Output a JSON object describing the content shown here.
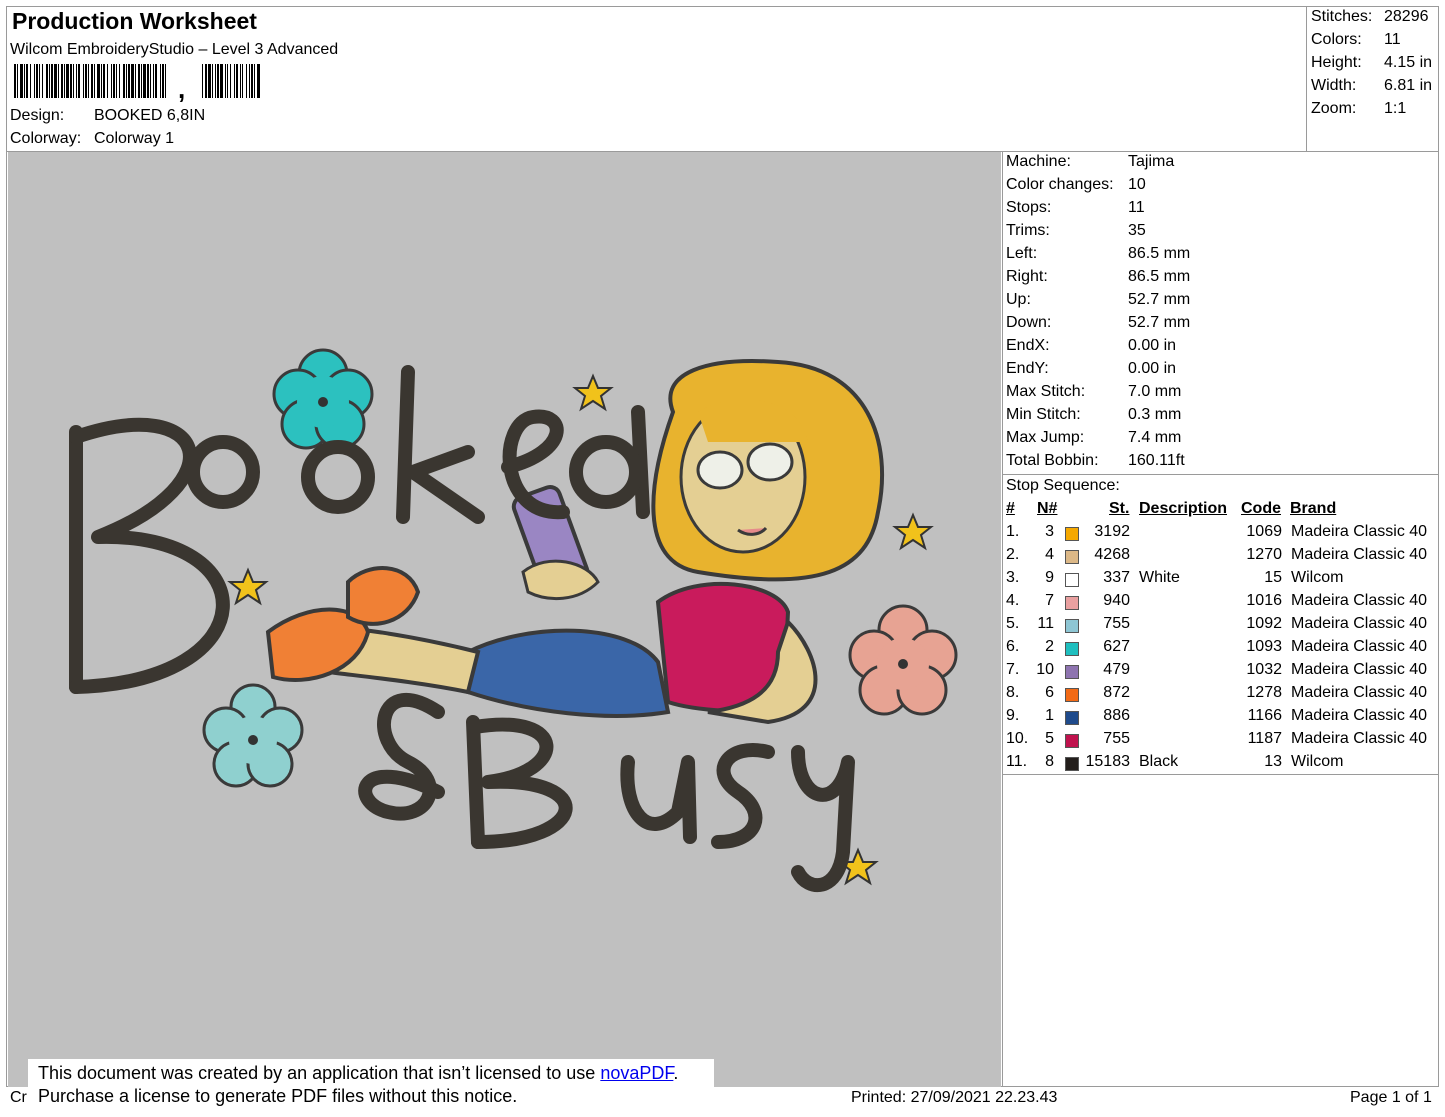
{
  "header": {
    "title": "Production Worksheet",
    "software": "Wilcom EmbroideryStudio – Level 3 Advanced",
    "barcode_mark": ",",
    "design_label": "Design:",
    "design_value": "BOOKED 6,8IN",
    "colorway_label": "Colorway:",
    "colorway_value": "Colorway 1"
  },
  "summary": [
    {
      "label": "Stitches:",
      "value": "28296"
    },
    {
      "label": "Colors:",
      "value": "11"
    },
    {
      "label": "Height:",
      "value": "4.15 in"
    },
    {
      "label": "Width:",
      "value": "6.81 in"
    },
    {
      "label": "Zoom:",
      "value": "1:1"
    }
  ],
  "properties": [
    {
      "label": "Machine:",
      "value": "Tajima"
    },
    {
      "label": "Color changes:",
      "value": "10"
    },
    {
      "label": "Stops:",
      "value": "11"
    },
    {
      "label": "Trims:",
      "value": "35"
    },
    {
      "label": "Left:",
      "value": "86.5 mm"
    },
    {
      "label": "Right:",
      "value": "86.5 mm"
    },
    {
      "label": "Up:",
      "value": "52.7 mm"
    },
    {
      "label": "Down:",
      "value": "52.7 mm"
    },
    {
      "label": "EndX:",
      "value": "0.00 in"
    },
    {
      "label": "EndY:",
      "value": "0.00 in"
    },
    {
      "label": "Max Stitch:",
      "value": "7.0 mm"
    },
    {
      "label": "Min Stitch:",
      "value": "0.3 mm"
    },
    {
      "label": "Max Jump:",
      "value": "7.4 mm"
    },
    {
      "label": "Total Bobbin:",
      "value": "160.11ft"
    }
  ],
  "stop_sequence": {
    "title": "Stop Sequence:",
    "headers": {
      "num": "#",
      "n": "N#",
      "st": "St.",
      "desc": "Description",
      "code": "Code",
      "brand": "Brand"
    },
    "rows": [
      {
        "num": "1.",
        "n": "3",
        "color": "#f5a800",
        "st": "3192",
        "desc": "",
        "code": "1069",
        "brand": "Madeira Classic 40"
      },
      {
        "num": "2.",
        "n": "4",
        "color": "#dcb887",
        "st": "4268",
        "desc": "",
        "code": "1270",
        "brand": "Madeira Classic 40"
      },
      {
        "num": "3.",
        "n": "9",
        "color": "#ffffff",
        "st": "337",
        "desc": "White",
        "code": "15",
        "brand": "Wilcom"
      },
      {
        "num": "4.",
        "n": "7",
        "color": "#e9a0a0",
        "st": "940",
        "desc": "",
        "code": "1016",
        "brand": "Madeira Classic 40"
      },
      {
        "num": "5.",
        "n": "11",
        "color": "#8ec6d4",
        "st": "755",
        "desc": "",
        "code": "1092",
        "brand": "Madeira Classic 40"
      },
      {
        "num": "6.",
        "n": "2",
        "color": "#1fbfbf",
        "st": "627",
        "desc": "",
        "code": "1093",
        "brand": "Madeira Classic 40"
      },
      {
        "num": "7.",
        "n": "10",
        "color": "#8e74b0",
        "st": "479",
        "desc": "",
        "code": "1032",
        "brand": "Madeira Classic 40"
      },
      {
        "num": "8.",
        "n": "6",
        "color": "#f26a16",
        "st": "872",
        "desc": "",
        "code": "1278",
        "brand": "Madeira Classic 40"
      },
      {
        "num": "9.",
        "n": "1",
        "color": "#1f4b8c",
        "st": "886",
        "desc": "",
        "code": "1166",
        "brand": "Madeira Classic 40"
      },
      {
        "num": "10.",
        "n": "5",
        "color": "#c0124e",
        "st": "755",
        "desc": "",
        "code": "1187",
        "brand": "Madeira Classic 40"
      },
      {
        "num": "11.",
        "n": "8",
        "color": "#231e1b",
        "st": "15183",
        "desc": "Black",
        "code": "13",
        "brand": "Wilcom"
      }
    ]
  },
  "notice": {
    "line1_prefix": "This document was created by an application that isn’t licensed to use ",
    "link": "novaPDF",
    "line1_suffix": ".",
    "line2": "Purchase a license to generate PDF files without this notice."
  },
  "footer": {
    "left": "Cr",
    "printed": "Printed: 27/09/2021 22.23.43",
    "page": "Page 1 of 1"
  },
  "design_artwork": {
    "text_top": "Booked",
    "text_bottom": "&Busy",
    "background_color": "#c0c0c0"
  }
}
